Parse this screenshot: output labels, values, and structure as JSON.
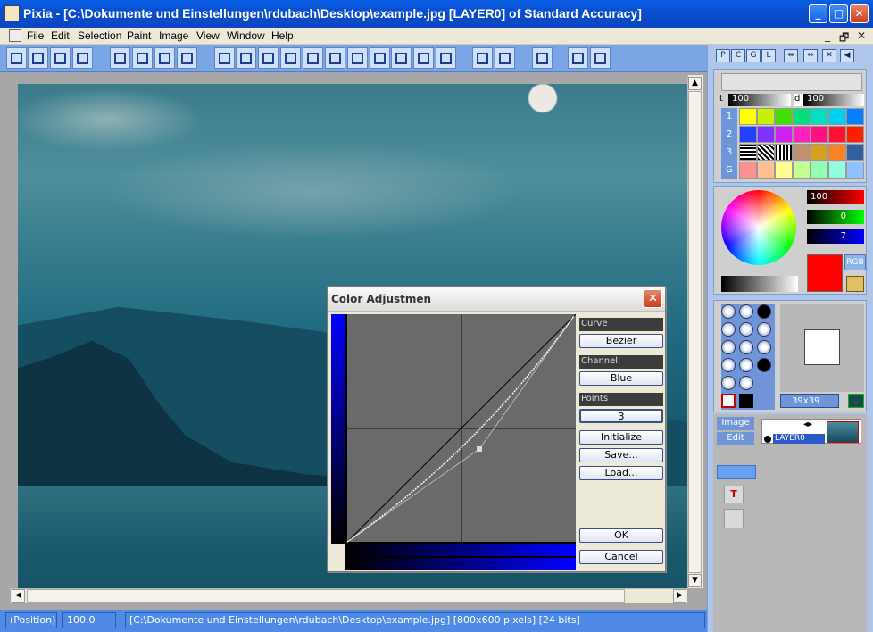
{
  "window": {
    "title": "Pixia - [C:\\Dokumente und Einstellungen\\rdubach\\Desktop\\example.jpg [LAYER0] of Standard Accuracy]",
    "min_glyph": "_",
    "max_glyph": "□",
    "close_glyph": "✕"
  },
  "menu": {
    "items": [
      "File",
      "Edit",
      "Selection",
      "Paint",
      "Image",
      "View",
      "Window",
      "Help"
    ],
    "mdi": {
      "min": "_",
      "restore": "🗗",
      "close": "✕"
    }
  },
  "colors": {
    "titlebar": "#0a4fcf",
    "toolbar": "#7aa6e6",
    "status": "#4f8be6",
    "curve_plot": "#6a6a6a",
    "channel_blue": "#0000ff"
  },
  "status": {
    "position": "(Position)",
    "zoom": "100.0",
    "file": "[C:\\Dokumente und Einstellungen\\rdubach\\Desktop\\example.jpg] [800x600 pixels] [24 bits]"
  },
  "dialog": {
    "title": "Color Adjustmen",
    "curve_label": "Curve",
    "curve_value": "Bezier",
    "channel_label": "Channel",
    "channel_value": "Blue",
    "points_label": "Points",
    "points_value": "3",
    "initialize": "Initialize",
    "save": "Save...",
    "load": "Load...",
    "ok": "OK",
    "cancel": "Cancel"
  },
  "panel": {
    "tabs": [
      "P",
      "C",
      "G",
      "L"
    ],
    "t_label": "t",
    "t_value": "100",
    "d_label": "d",
    "d_value": "100",
    "palette_rows": [
      "1",
      "2",
      "3",
      "G"
    ],
    "red_value": "100",
    "green_value": "0",
    "blue_value": "7",
    "rgb_label": "RGB",
    "brush_size": "39x39",
    "image_label": "Image",
    "edit_label": "Edit",
    "layer_name": "LAYER0",
    "current_color": "#ff0000"
  }
}
